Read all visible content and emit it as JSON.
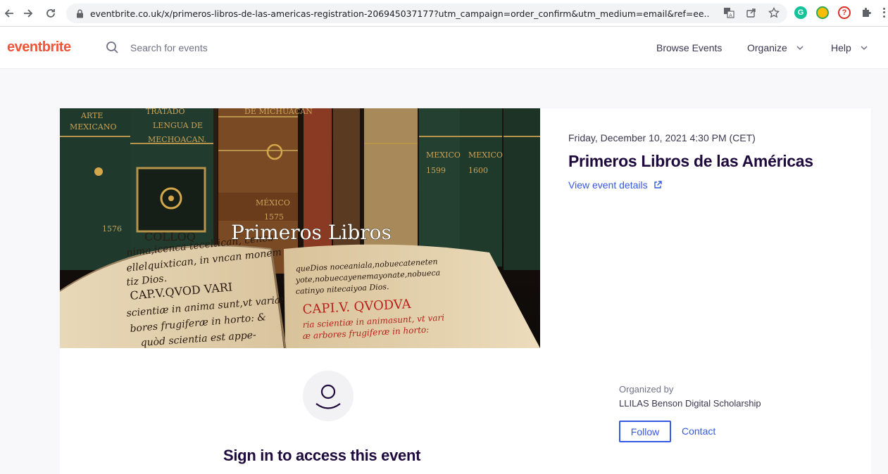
{
  "browser": {
    "url": "eventbrite.co.uk/x/primeros-libros-de-las-americas-registration-206945037177?utm_campaign=order_confirm&utm_medium=email&ref=ee...",
    "back_icon": "arrow-left-icon",
    "forward_icon": "arrow-right-icon",
    "reload_icon": "reload-icon"
  },
  "header": {
    "logo": "eventbrite",
    "search_placeholder": "Search for events",
    "nav": {
      "browse": "Browse Events",
      "organize": "Organize",
      "help": "Help"
    }
  },
  "hero": {
    "image_overlay_text": "Primeros Libros",
    "date": "Friday, December 10, 2021 4:30 PM (CET)",
    "title": "Primeros Libros de las Américas",
    "details_link": "View event details"
  },
  "signin": {
    "title": "Sign in to access this event"
  },
  "organizer": {
    "label": "Organized by",
    "name": "LLILAS Benson Digital Scholarship",
    "follow": "Follow",
    "contact": "Contact"
  },
  "colors": {
    "brand": "#f05537",
    "link": "#3659e3",
    "title": "#1e0a3c"
  }
}
